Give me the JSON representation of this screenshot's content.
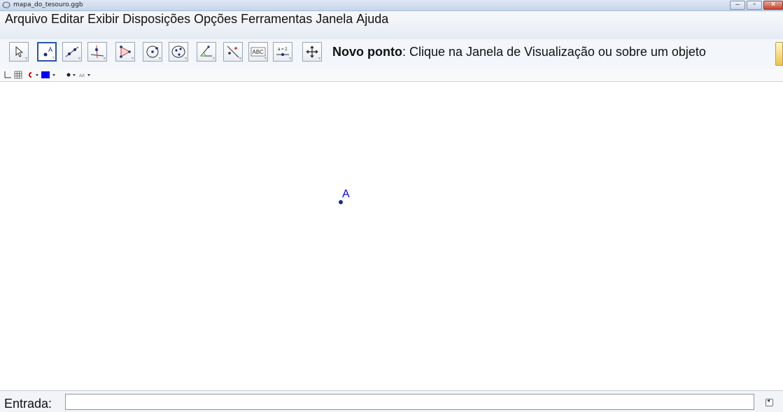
{
  "window": {
    "title": "mapa_do_tesouro.ggb",
    "icons": [
      "geogebra-app-icon",
      "minimize-icon",
      "maximize-icon",
      "close-icon"
    ]
  },
  "menu": {
    "items": [
      "Arquivo",
      "Editar",
      "Exibir",
      "Disposições",
      "Opções",
      "Ferramentas",
      "Janela",
      "Ajuda"
    ]
  },
  "toolbar": {
    "tools": [
      {
        "name": "move",
        "icon": "arrow-cursor-icon"
      },
      {
        "name": "new-point",
        "icon": "point-icon",
        "selected": true
      },
      {
        "name": "line",
        "icon": "line-through-two-points-icon"
      },
      {
        "name": "perpendicular",
        "icon": "perpendicular-line-icon"
      },
      {
        "name": "polygon",
        "icon": "polygon-icon"
      },
      {
        "name": "circle",
        "icon": "circle-center-point-icon"
      },
      {
        "name": "conic",
        "icon": "ellipse-icon"
      },
      {
        "name": "angle",
        "icon": "angle-icon"
      },
      {
        "name": "reflect",
        "icon": "reflect-about-line-icon"
      },
      {
        "name": "text",
        "icon": "text-abc-icon",
        "label": "ABC"
      },
      {
        "name": "slider",
        "icon": "slider-icon",
        "label": "a = 2"
      },
      {
        "name": "move-view",
        "icon": "move-graphics-view-icon"
      }
    ],
    "tool_help_title": "Novo ponto",
    "tool_help_text": ": Clique na Janela de Visualização ou sobre um objeto"
  },
  "stylebar": {
    "items": [
      "axes-toggle-icon",
      "grid-toggle-icon",
      "point-capture-icon",
      "color-icon",
      "point-style-icon",
      "label-style-icon"
    ],
    "colors": {
      "color_swatch": "#0000ff",
      "capture": "#cc0000"
    }
  },
  "canvas": {
    "point_label": "A",
    "point_color": "#0000ff"
  },
  "input": {
    "label": "Entrada:",
    "value": "",
    "help_icon": "input-help-icon"
  }
}
